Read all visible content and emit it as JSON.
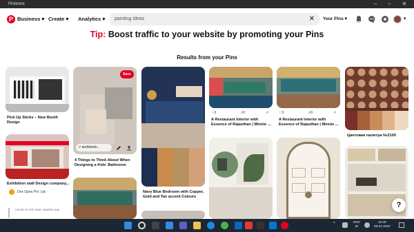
{
  "window": {
    "title": "Pinterest"
  },
  "nav": {
    "business": "Business",
    "create": "Create",
    "analytics": "Analytics",
    "account_switch": "Your Pins"
  },
  "search": {
    "value": "painting ideas"
  },
  "tip": {
    "prefix": "Tip:",
    "text": "Boost traffic to your website by promoting your Pins"
  },
  "results_title": "Results from your Pins",
  "pins": [
    {
      "caption": "Pick Up Sticks – New Booth Design"
    },
    {
      "caption": "Exhibition stall Design company...",
      "author": "Dex Opes Pvt. Ltd."
    },
    {
      "caption": "4 Things to Think About When Designing a Kids' Bathroom",
      "link": "architecte...",
      "save": "Save"
    },
    {
      "caption": "Navy Blue Bedroom with Copper, Gold and Tan accent Colours"
    },
    {
      "caption": "A Restaurant Interior with Essence of Rajasthan | Minnie ...",
      "reactions": "0",
      "saves": "0"
    },
    {
      "caption": "A Restaurant Interior with Essence of Rajasthan | Minnie ...",
      "reactions": "0",
      "saves": "0"
    },
    {
      "caption": "Цветовая палитра №2100"
    }
  ],
  "partial_text": "COLOR OF THE YEAR: CAVERN CLAY",
  "help_label": "?",
  "taskbar": {
    "lang_1": "ENG",
    "lang_2": "IN",
    "time": "22:29",
    "date": "09-01-2022"
  },
  "colors": {
    "accent": "#e60023",
    "taskbar": "#1c2733"
  }
}
